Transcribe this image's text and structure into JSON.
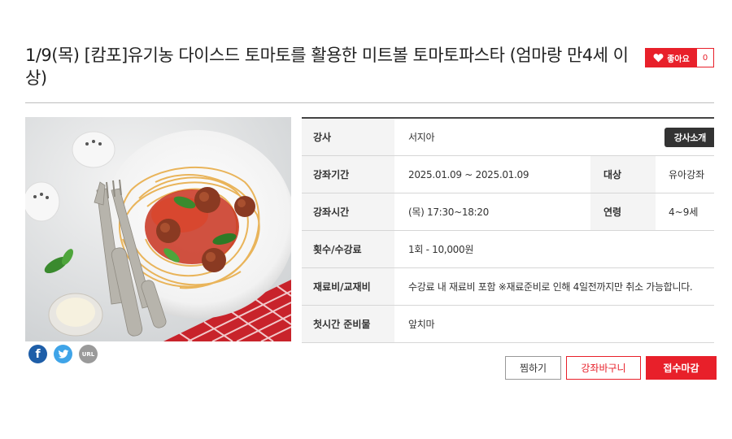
{
  "course": {
    "title": "1/9(목) [캄포]유기농 다이스드 토마토를 활용한 미트볼 토마토파스타 (엄마랑 만4세 이상)"
  },
  "like": {
    "label": "좋아요",
    "count": "0",
    "icon": "heart-icon"
  },
  "share": {
    "facebook": {
      "icon": "facebook-icon",
      "glyph": "f"
    },
    "twitter": {
      "icon": "twitter-icon"
    },
    "url": {
      "icon": "url-icon",
      "label": "URL"
    }
  },
  "info": {
    "instructor_label": "강사",
    "instructor_value": "서지아",
    "instructor_button": "강사소개",
    "period_label": "강좌기간",
    "period_value": "2025.01.09 ~ 2025.01.09",
    "target_label": "대상",
    "target_value": "유아강좌",
    "time_label": "강좌시간",
    "time_value": "(목) 17:30~18:20",
    "age_label": "연령",
    "age_value": "4~9세",
    "fee_label": "횟수/수강료",
    "fee_value": "1회 - 10,000원",
    "material_label": "재료비/교재비",
    "material_value": "수강료 내 재료비 포함 ※재료준비로 인해 4일전까지만 취소 가능합니다.",
    "prep_label": "첫시간 준비물",
    "prep_value": "앞치마"
  },
  "buttons": {
    "wish": "찜하기",
    "cart": "강좌바구니",
    "closed": "접수마감"
  },
  "colors": {
    "accent": "#e8202a",
    "dark": "#333333",
    "header_bg": "#f4f4f4"
  }
}
